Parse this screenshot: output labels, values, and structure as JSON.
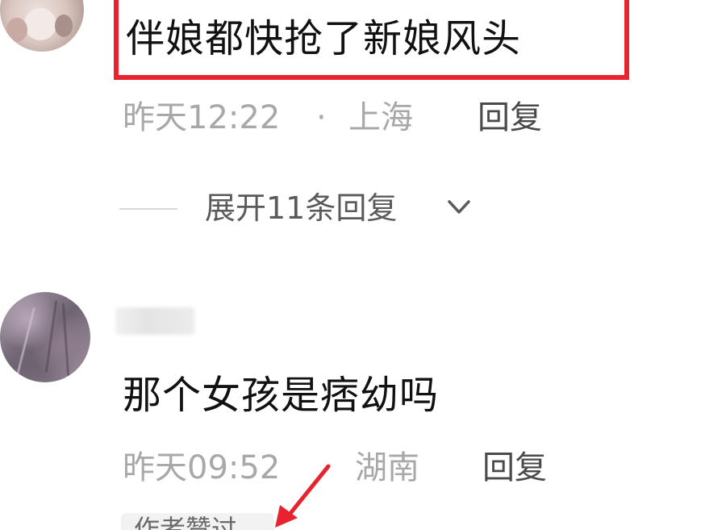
{
  "comments": [
    {
      "text": "伴娘都快抢了新娘风头",
      "time": "昨天12:22",
      "separator": "·",
      "location": "上海",
      "reply_label": "回复",
      "highlighted": true,
      "highlight_color": "#e8222e"
    },
    {
      "username": "",
      "text": "那个女孩是痞幼吗",
      "time": "昨天09:52",
      "location": "湖南",
      "reply_label": "回复",
      "badge": "作者赞过"
    }
  ],
  "expand_replies": {
    "label": "展开11条回复",
    "icon": "chevron-down-icon"
  },
  "annotations": {
    "arrow_icon": "red-arrow-icon",
    "arrow_color": "#e8222e"
  }
}
